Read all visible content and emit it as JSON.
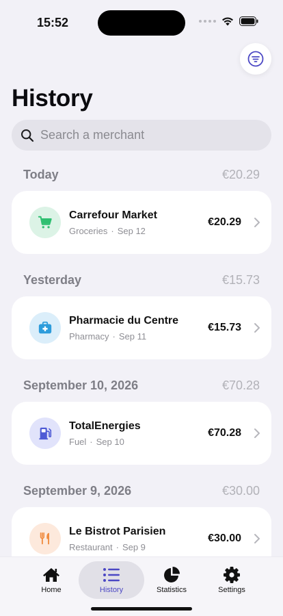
{
  "status_bar": {
    "time": "15:52"
  },
  "header": {
    "title": "History",
    "filter_icon": "filter-icon"
  },
  "search": {
    "placeholder": "Search a merchant"
  },
  "days": [
    {
      "label": "Today",
      "total": "€20.29",
      "transaction": {
        "merchant": "Carrefour Market",
        "category": "Groceries",
        "date": "Sep 12",
        "amount": "€20.29",
        "icon": "cart-icon",
        "icon_bg": "#dcf3e6",
        "icon_color": "#2fbf71"
      }
    },
    {
      "label": "Yesterday",
      "total": "€15.73",
      "transaction": {
        "merchant": "Pharmacie du Centre",
        "category": "Pharmacy",
        "date": "Sep 11",
        "amount": "€15.73",
        "icon": "medical-kit-icon",
        "icon_bg": "#dbeefa",
        "icon_color": "#2d9cdb"
      }
    },
    {
      "label": "September 10, 2026",
      "total": "€70.28",
      "transaction": {
        "merchant": "TotalEnergies",
        "category": "Fuel",
        "date": "Sep 10",
        "amount": "€70.28",
        "icon": "fuel-pump-icon",
        "icon_bg": "#e1e3fb",
        "icon_color": "#4f5bd5"
      }
    },
    {
      "label": "September 9, 2026",
      "total": "€30.00",
      "transaction": {
        "merchant": "Le Bistrot Parisien",
        "category": "Restaurant",
        "date": "Sep 9",
        "amount": "€30.00",
        "icon": "fork-knife-icon",
        "icon_bg": "#fde9dc",
        "icon_color": "#f08a3c"
      }
    }
  ],
  "tabs": [
    {
      "label": "Home",
      "icon": "home-icon",
      "active": false
    },
    {
      "label": "History",
      "icon": "list-icon",
      "active": true
    },
    {
      "label": "Statistics",
      "icon": "pie-chart-icon",
      "active": false
    },
    {
      "label": "Settings",
      "icon": "gear-icon",
      "active": false
    }
  ],
  "colors": {
    "accent": "#4b47c4",
    "background": "#f2f1f7"
  }
}
